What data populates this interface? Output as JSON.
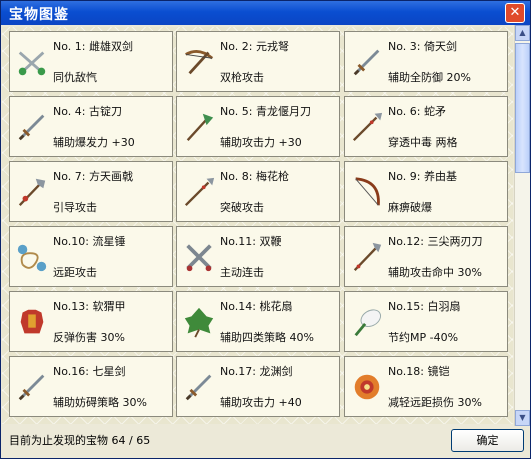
{
  "window": {
    "title": "宝物图鉴",
    "close_label": "✕"
  },
  "items": [
    {
      "name": "No. 1: 雌雄双剑",
      "desc": "同仇敌忾",
      "icon": "twin-swords-icon"
    },
    {
      "name": "No. 2: 元戎弩",
      "desc": "双枪攻击",
      "icon": "crossbow-icon"
    },
    {
      "name": "No. 3: 倚天剑",
      "desc": "辅助全防御 20%",
      "icon": "sword-icon"
    },
    {
      "name": "No. 4: 古锭刀",
      "desc": "辅助爆发力 +30",
      "icon": "sword-icon"
    },
    {
      "name": "No. 5: 青龙偃月刀",
      "desc": "辅助攻击力 +30",
      "icon": "glaive-icon"
    },
    {
      "name": "No. 6: 蛇矛",
      "desc": "穿透中毒  两格",
      "icon": "spear-icon"
    },
    {
      "name": "No. 7: 方天画戟",
      "desc": "引导攻击",
      "icon": "halberd-icon"
    },
    {
      "name": "No. 8: 梅花枪",
      "desc": "突破攻击",
      "icon": "spear-icon"
    },
    {
      "name": "No. 9: 养由基",
      "desc": "麻痹破爆",
      "icon": "bow-icon"
    },
    {
      "name": "No.10: 流星锤",
      "desc": "远距攻击",
      "icon": "meteor-hammer-icon"
    },
    {
      "name": "No.11: 双鞭",
      "desc": "主动连击",
      "icon": "twin-whips-icon"
    },
    {
      "name": "No.12: 三尖两刃刀",
      "desc": "辅助攻击命中 30%",
      "icon": "trident-blade-icon"
    },
    {
      "name": "No.13: 软猬甲",
      "desc": "反弹伤害 30%",
      "icon": "armor-icon"
    },
    {
      "name": "No.14: 桃花扇",
      "desc": "辅助四类策略 40%",
      "icon": "leaf-fan-icon"
    },
    {
      "name": "No.15: 白羽扇",
      "desc": "节约MP -40%",
      "icon": "feather-fan-icon"
    },
    {
      "name": "No.16: 七星剑",
      "desc": "辅助妨碍策略 30%",
      "icon": "sword-icon"
    },
    {
      "name": "No.17: 龙渊剑",
      "desc": "辅助攻击力 +40",
      "icon": "sword-icon"
    },
    {
      "name": "No.18: 镜铠",
      "desc": "减轻远距损伤 30%",
      "icon": "mirror-armor-icon"
    }
  ],
  "status": {
    "label": "目前为止发现的宝物 64 / 65"
  },
  "ok_label": "确定",
  "scrollbar": {
    "up_label": "▲",
    "down_label": "▼"
  },
  "colors": {
    "titlebar": "#0a4ed1",
    "card_bg": "#fbf9ea",
    "card_border": "#8b8a7d",
    "close": "#e04a2a"
  }
}
